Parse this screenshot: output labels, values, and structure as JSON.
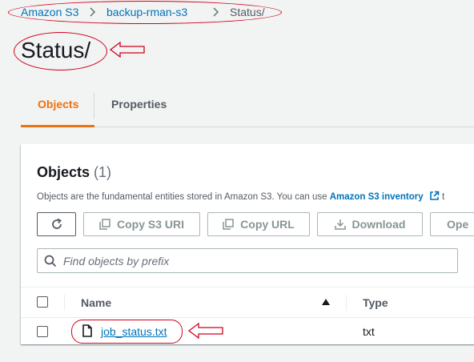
{
  "breadcrumb": {
    "items": [
      "Amazon S3",
      "backup-rman-s3",
      "Status/"
    ]
  },
  "page": {
    "title": "Status/"
  },
  "tabs": [
    {
      "label": "Objects",
      "active": true
    },
    {
      "label": "Properties",
      "active": false
    }
  ],
  "objects_panel": {
    "title": "Objects",
    "count": "(1)",
    "description": "Objects are the fundamental entities stored in Amazon S3. You can use",
    "description_link": "Amazon S3 inventory",
    "description_tail": "t",
    "buttons": {
      "copy_s3_uri": "Copy S3 URI",
      "copy_url": "Copy URL",
      "download": "Download",
      "open": "Ope"
    },
    "search": {
      "placeholder": "Find objects by prefix"
    },
    "table": {
      "columns": [
        "Name",
        "Type"
      ],
      "rows": [
        {
          "name": "job_status.txt",
          "type": "txt"
        }
      ]
    }
  },
  "colors": {
    "link": "#0073bb",
    "active_tab": "#ec7211",
    "annotation": "#d0021b"
  }
}
